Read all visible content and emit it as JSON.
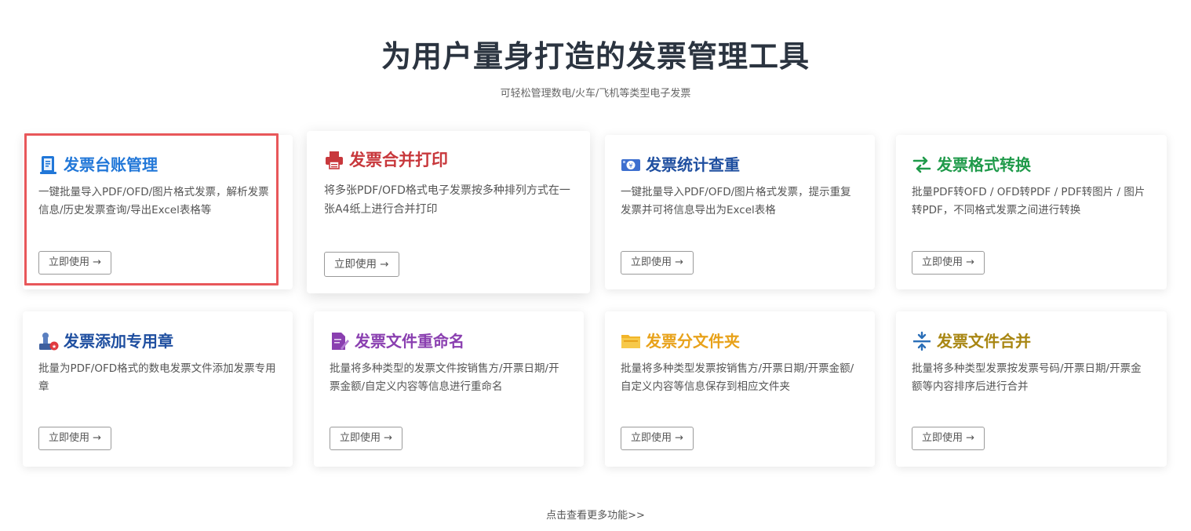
{
  "header": {
    "title": "为用户量身打造的发票管理工具",
    "subtitle": "可轻松管理数电/火车/飞机等类型电子发票"
  },
  "cards": [
    {
      "title": "发票台账管理",
      "title_color": "#2177d8",
      "icon": "ledger-icon",
      "description": "一键批量导入PDF/OFD/图片格式发票，解析发票信息/历史发票查询/导出Excel表格等",
      "button_label": "立即使用 →",
      "highlighted": true
    },
    {
      "title": "发票合并打印",
      "title_color": "#c8383c",
      "icon": "printer-icon",
      "description": "将多张PDF/OFD格式电子发票按多种排列方式在一张A4纸上进行合并打印",
      "button_label": "立即使用 →"
    },
    {
      "title": "发票统计查重",
      "title_color": "#1f4fa0",
      "icon": "statistics-icon",
      "description": "一键批量导入PDF/OFD/图片格式发票，提示重复发票并可将信息导出为Excel表格",
      "button_label": "立即使用 →"
    },
    {
      "title": "发票格式转换",
      "title_color": "#1f9a4a",
      "icon": "convert-arrows-icon",
      "description": "批量PDF转OFD / OFD转PDF / PDF转图片 / 图片转PDF，不同格式发票之间进行转换",
      "button_label": "立即使用 →"
    },
    {
      "title": "发票添加专用章",
      "title_color": "#1f4fa0",
      "icon": "stamp-icon",
      "description": "批量为PDF/OFD格式的数电发票文件添加发票专用章",
      "button_label": "立即使用 →"
    },
    {
      "title": "发票文件重命名",
      "title_color": "#8a3fb0",
      "icon": "rename-icon",
      "description": "批量将多种类型的发票文件按销售方/开票日期/开票金额/自定义内容等信息进行重命名",
      "button_label": "立即使用 →"
    },
    {
      "title": "发票分文件夹",
      "title_color": "#e8a21a",
      "icon": "folder-icon",
      "description": "批量将多种类型发票按销售方/开票日期/开票金额/自定义内容等信息保存到相应文件夹",
      "button_label": "立即使用 →"
    },
    {
      "title": "发票文件合并",
      "title_color": "#a88612",
      "icon": "merge-icon",
      "description": "批量将多种类型发票按发票号码/开票日期/开票金额等内容排序后进行合并",
      "button_label": "立即使用 →"
    }
  ],
  "footer": {
    "more_link": "点击查看更多功能>>"
  }
}
